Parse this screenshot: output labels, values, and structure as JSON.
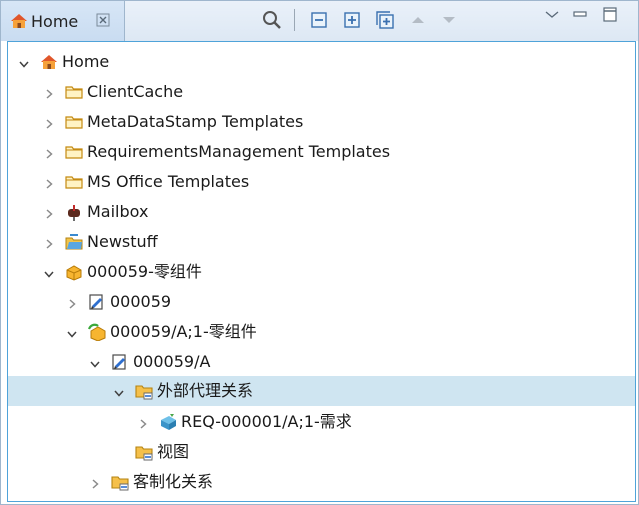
{
  "tab": {
    "label": "Home"
  },
  "tree": [
    {
      "label": "Home",
      "icon": "home-icon",
      "expander": "expanded"
    },
    {
      "label": "ClientCache",
      "icon": "folder-icon",
      "expander": "collapsed"
    },
    {
      "label": "MetaDataStamp Templates",
      "icon": "folder-icon",
      "expander": "collapsed"
    },
    {
      "label": "RequirementsManagement Templates",
      "icon": "folder-icon",
      "expander": "collapsed"
    },
    {
      "label": "MS Office Templates",
      "icon": "folder-icon",
      "expander": "collapsed"
    },
    {
      "label": "Mailbox",
      "icon": "mailbox-icon",
      "expander": "collapsed"
    },
    {
      "label": "Newstuff",
      "icon": "newstuff-folder-icon",
      "expander": "collapsed"
    },
    {
      "label": "000059-零组件",
      "icon": "item-icon",
      "expander": "expanded"
    },
    {
      "label": "000059",
      "icon": "item-master-icon",
      "expander": "collapsed"
    },
    {
      "label": "000059/A;1-零组件",
      "icon": "item-revision-icon",
      "expander": "expanded"
    },
    {
      "label": "000059/A",
      "icon": "item-master-icon",
      "expander": "expanded"
    },
    {
      "label": "外部代理关系",
      "icon": "relation-folder-icon",
      "expander": "expanded",
      "selected": true
    },
    {
      "label": "REQ-000001/A;1-需求",
      "icon": "requirement-icon",
      "expander": "collapsed"
    },
    {
      "label": "视图",
      "icon": "relation-folder-icon",
      "expander": "none"
    },
    {
      "label": "客制化关系",
      "icon": "relation-folder-icon",
      "expander": "collapsed"
    }
  ],
  "colors": {
    "selection": "#cfe5f1",
    "tab": "#c9dcf1",
    "border": "#4fa3d9"
  }
}
